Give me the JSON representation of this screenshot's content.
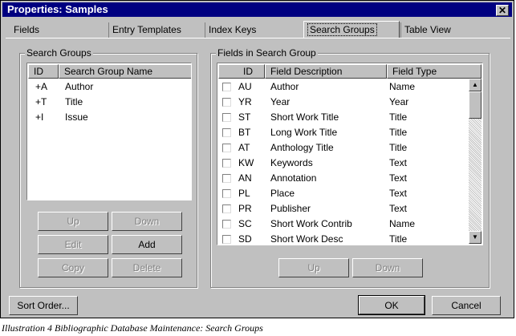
{
  "window": {
    "title": "Properties: Samples",
    "close_glyph": "✕"
  },
  "tabs": [
    {
      "label": "Fields",
      "active": false
    },
    {
      "label": "Entry Templates",
      "active": false
    },
    {
      "label": "Index Keys",
      "active": false
    },
    {
      "label": "Search Groups",
      "active": true
    },
    {
      "label": "Table View",
      "active": false
    }
  ],
  "search_groups": {
    "title": "Search Groups",
    "columns": [
      "ID",
      "Search Group Name"
    ],
    "rows": [
      {
        "id": "+A",
        "name": "Author"
      },
      {
        "id": "+T",
        "name": "Title"
      },
      {
        "id": "+I",
        "name": "Issue"
      }
    ],
    "buttons": {
      "up": "Up",
      "down": "Down",
      "edit": "Edit",
      "add": "Add",
      "copy": "Copy",
      "delete": "Delete"
    }
  },
  "fields_in_group": {
    "title": "Fields in Search Group",
    "columns": [
      "ID",
      "Field Description",
      "Field Type"
    ],
    "rows": [
      {
        "id": "AU",
        "description": "Author",
        "type": "Name"
      },
      {
        "id": "YR",
        "description": "Year",
        "type": "Year"
      },
      {
        "id": "ST",
        "description": "Short Work Title",
        "type": "Title"
      },
      {
        "id": "BT",
        "description": "Long Work Title",
        "type": "Title"
      },
      {
        "id": "AT",
        "description": "Anthology Title",
        "type": "Title"
      },
      {
        "id": "KW",
        "description": "Keywords",
        "type": "Text"
      },
      {
        "id": "AN",
        "description": "Annotation",
        "type": "Text"
      },
      {
        "id": "PL",
        "description": "Place",
        "type": "Text"
      },
      {
        "id": "PR",
        "description": "Publisher",
        "type": "Text"
      },
      {
        "id": "SC",
        "description": "Short Work Contrib",
        "type": "Name"
      },
      {
        "id": "SD",
        "description": "Short Work Desc",
        "type": "Title"
      }
    ],
    "buttons": {
      "up": "Up",
      "down": "Down"
    },
    "scroll_up_glyph": "▲",
    "scroll_down_glyph": "▼"
  },
  "footer": {
    "sort_order": "Sort Order...",
    "ok": "OK",
    "cancel": "Cancel"
  },
  "caption": "Illustration 4 Bibliographic Database Maintenance: Search Groups"
}
